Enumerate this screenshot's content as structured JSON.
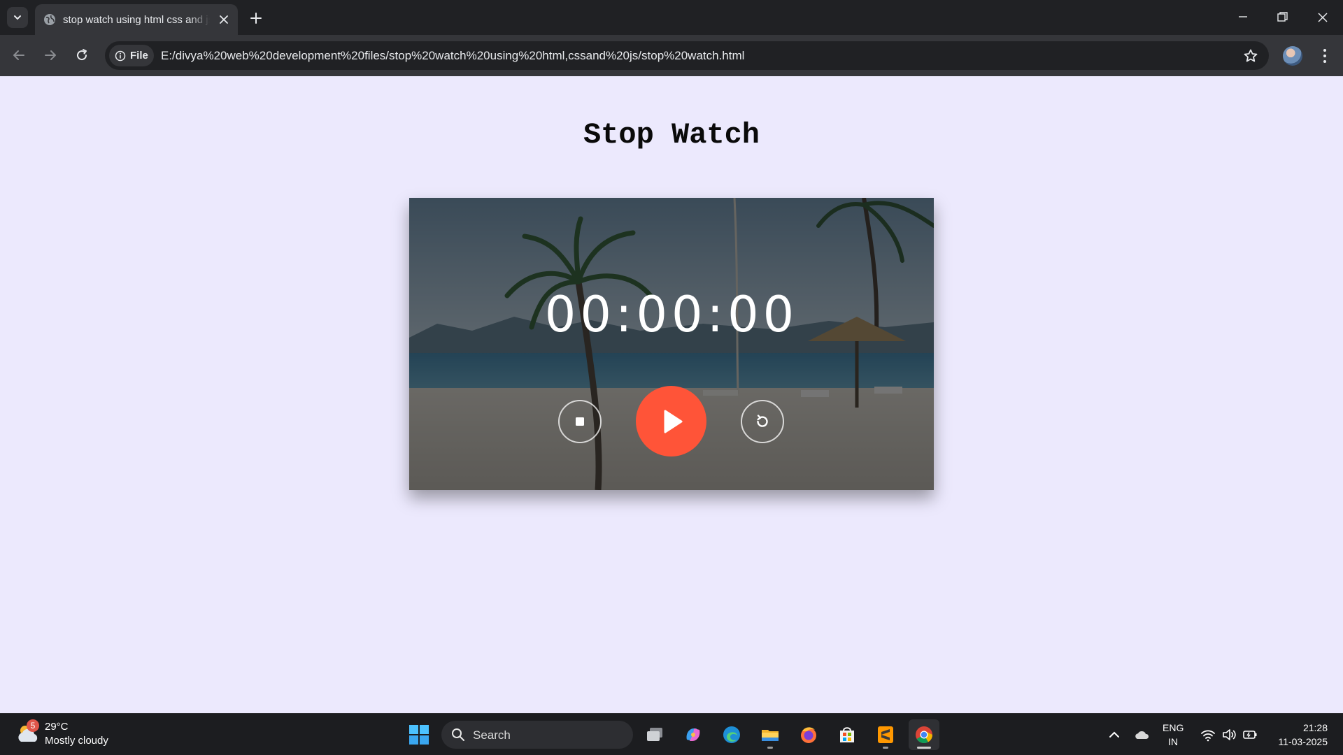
{
  "browser": {
    "tab_title": "stop watch using html css and js",
    "omnibox_chip": "File",
    "url": "E:/divya%20web%20development%20files/stop%20watch%20using%20html,cssand%20js/stop%20watch.html"
  },
  "page": {
    "title": "Stop Watch",
    "time": "00:00:00",
    "controls": {
      "stop_icon": "stop-icon",
      "play_icon": "play-icon",
      "reset_icon": "reset-icon",
      "play_color": "#ff5438"
    }
  },
  "taskbar": {
    "weather_badge": "5",
    "weather_temp": "29°C",
    "weather_desc": "Mostly cloudy",
    "search_label": "Search",
    "apps": [
      "task-view",
      "copilot",
      "edge",
      "file-explorer",
      "firefox",
      "microsoft-store",
      "sublime-text",
      "chrome"
    ],
    "language_line1": "ENG",
    "language_line2": "IN",
    "time": "21:28",
    "date": "11-03-2025"
  },
  "colors": {
    "page_background": "#ece9fd",
    "chrome_dark": "#202124",
    "chrome_toolbar": "#35363a"
  }
}
